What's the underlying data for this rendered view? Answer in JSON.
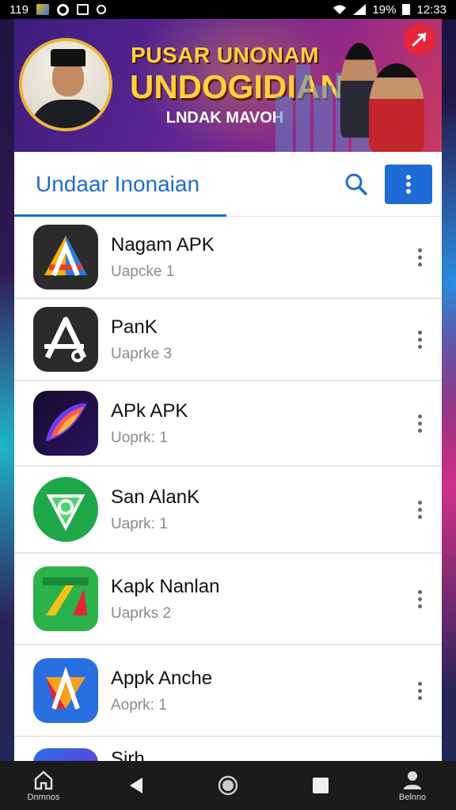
{
  "status_bar": {
    "left_text": "119",
    "battery": "19%",
    "time": "12:33"
  },
  "banner": {
    "line1": "PUSAR UNONAM",
    "line2": "UNDOGIDIAN",
    "line3": "LNDAK MAVOH"
  },
  "header": {
    "title": "Undaar Inonaian"
  },
  "apps": [
    {
      "name": "Nagam APK",
      "sub": "Uapcke 1",
      "icon": "triangle-app-icon"
    },
    {
      "name": "PanK",
      "sub": "Uaprke 3",
      "icon": "letter-a-app-icon"
    },
    {
      "name": "APk APK",
      "sub": "Uoprk: 1",
      "icon": "swoosh-app-icon"
    },
    {
      "name": "San AlanK",
      "sub": "Uaprk: 1",
      "icon": "green-shield-app-icon"
    },
    {
      "name": "Kapk Nanlan",
      "sub": "Uaprks 2",
      "icon": "green-logo-app-icon"
    },
    {
      "name": "Appk Anche",
      "sub": "Aoprk: 1",
      "icon": "blue-a-app-icon"
    },
    {
      "name": "Sirh",
      "sub": "",
      "icon": "partial-app-icon"
    }
  ],
  "nav": {
    "home_label": "Dnmnos",
    "profile_label": "Belnno"
  }
}
